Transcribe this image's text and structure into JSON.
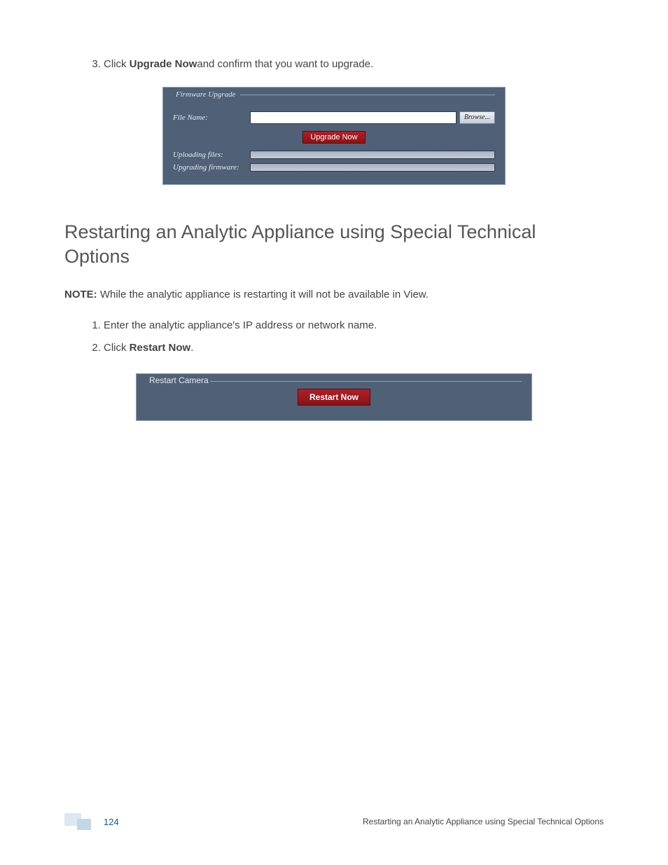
{
  "step3": {
    "prefix": "Click ",
    "bold": "Upgrade Now",
    "suffix": "and confirm that you want to upgrade."
  },
  "firmwarePanel": {
    "legend": "Firmware Upgrade",
    "fileNameLabel": "File Name:",
    "browseLabel": "Browse...",
    "upgradeNowLabel": "Upgrade Now",
    "uploadingLabel": "Uploading files:",
    "upgradingLabel": "Upgrading firmware:"
  },
  "heading": "Restarting an Analytic Appliance using Special Technical Options",
  "note": {
    "bold": "NOTE:",
    "text": " While the analytic appliance is restarting it will not be available in View."
  },
  "steps": [
    "Enter the analytic appliance's IP address or network name.",
    {
      "prefix": "Click ",
      "bold": "Restart Now",
      "suffix": "."
    }
  ],
  "restartPanel": {
    "legend": "Restart Camera",
    "buttonLabel": "Restart Now"
  },
  "footer": {
    "pageNumber": "124",
    "rightText": "Restarting an Analytic Appliance using Special Technical Options"
  }
}
